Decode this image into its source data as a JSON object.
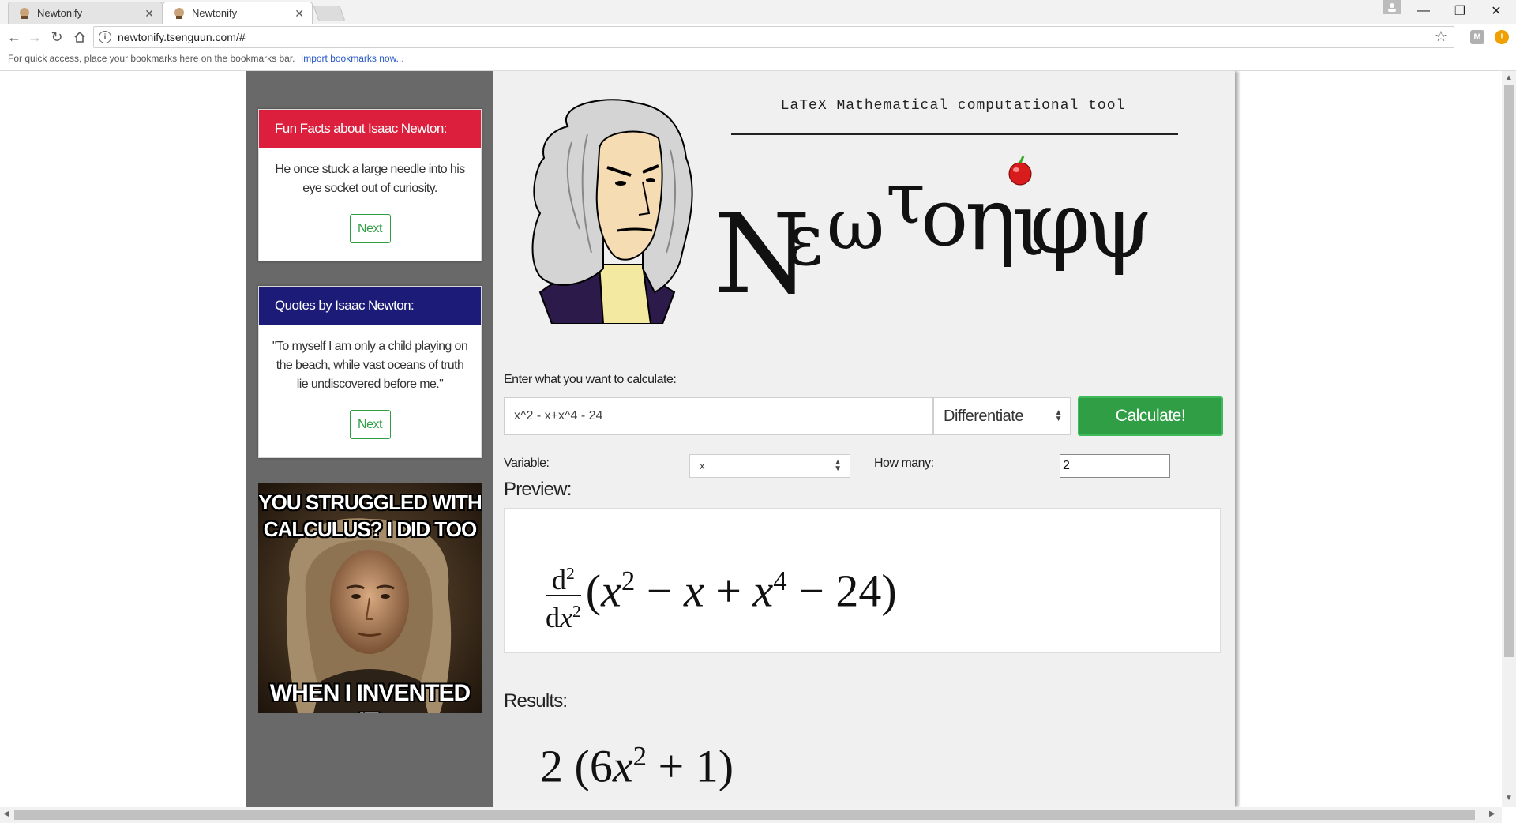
{
  "browser": {
    "tabs": [
      {
        "title": "Newtonify",
        "active": false
      },
      {
        "title": "Newtonify",
        "active": true
      }
    ],
    "url": "newtonify.tsenguun.com/#",
    "bookmarks_prompt": "For quick access, place your bookmarks here on the bookmarks bar.",
    "bookmarks_link": "Import bookmarks now...",
    "extensions": [
      "M",
      "!"
    ]
  },
  "sidebar": {
    "fun_facts": {
      "title": "Fun Facts about Isaac Newton:",
      "text": "He once stuck a large needle into his eye socket out of curiosity.",
      "next_label": "Next",
      "header_color": "#dc1f3c"
    },
    "quotes": {
      "title": "Quotes by Isaac Newton:",
      "text": "\"To myself I am only a child playing on the beach, while vast oceans of truth lie undiscovered before me.\"",
      "next_label": "Next",
      "header_color": "#1c1c78"
    },
    "meme": {
      "top_line1": "YOU STRUGGLED WITH",
      "top_line2": "CALCULUS? I DID TOO",
      "bottom_line": "WHEN I INVENTED IT."
    }
  },
  "main": {
    "tagline": "LaTeX Mathematical computational tool",
    "logo_text": "Νεωτοηιφψ",
    "input_label": "Enter what you want to calculate:",
    "expression": "x^2 - x+x^4 - 24",
    "operation": "Differentiate",
    "calculate_label": "Calculate!",
    "variable_label": "Variable:",
    "variable_value": "x",
    "how_many_label": "How many:",
    "how_many_value": "2",
    "preview_heading": "Preview:",
    "results_heading": "Results:",
    "accent_color": "#2f9e44"
  }
}
